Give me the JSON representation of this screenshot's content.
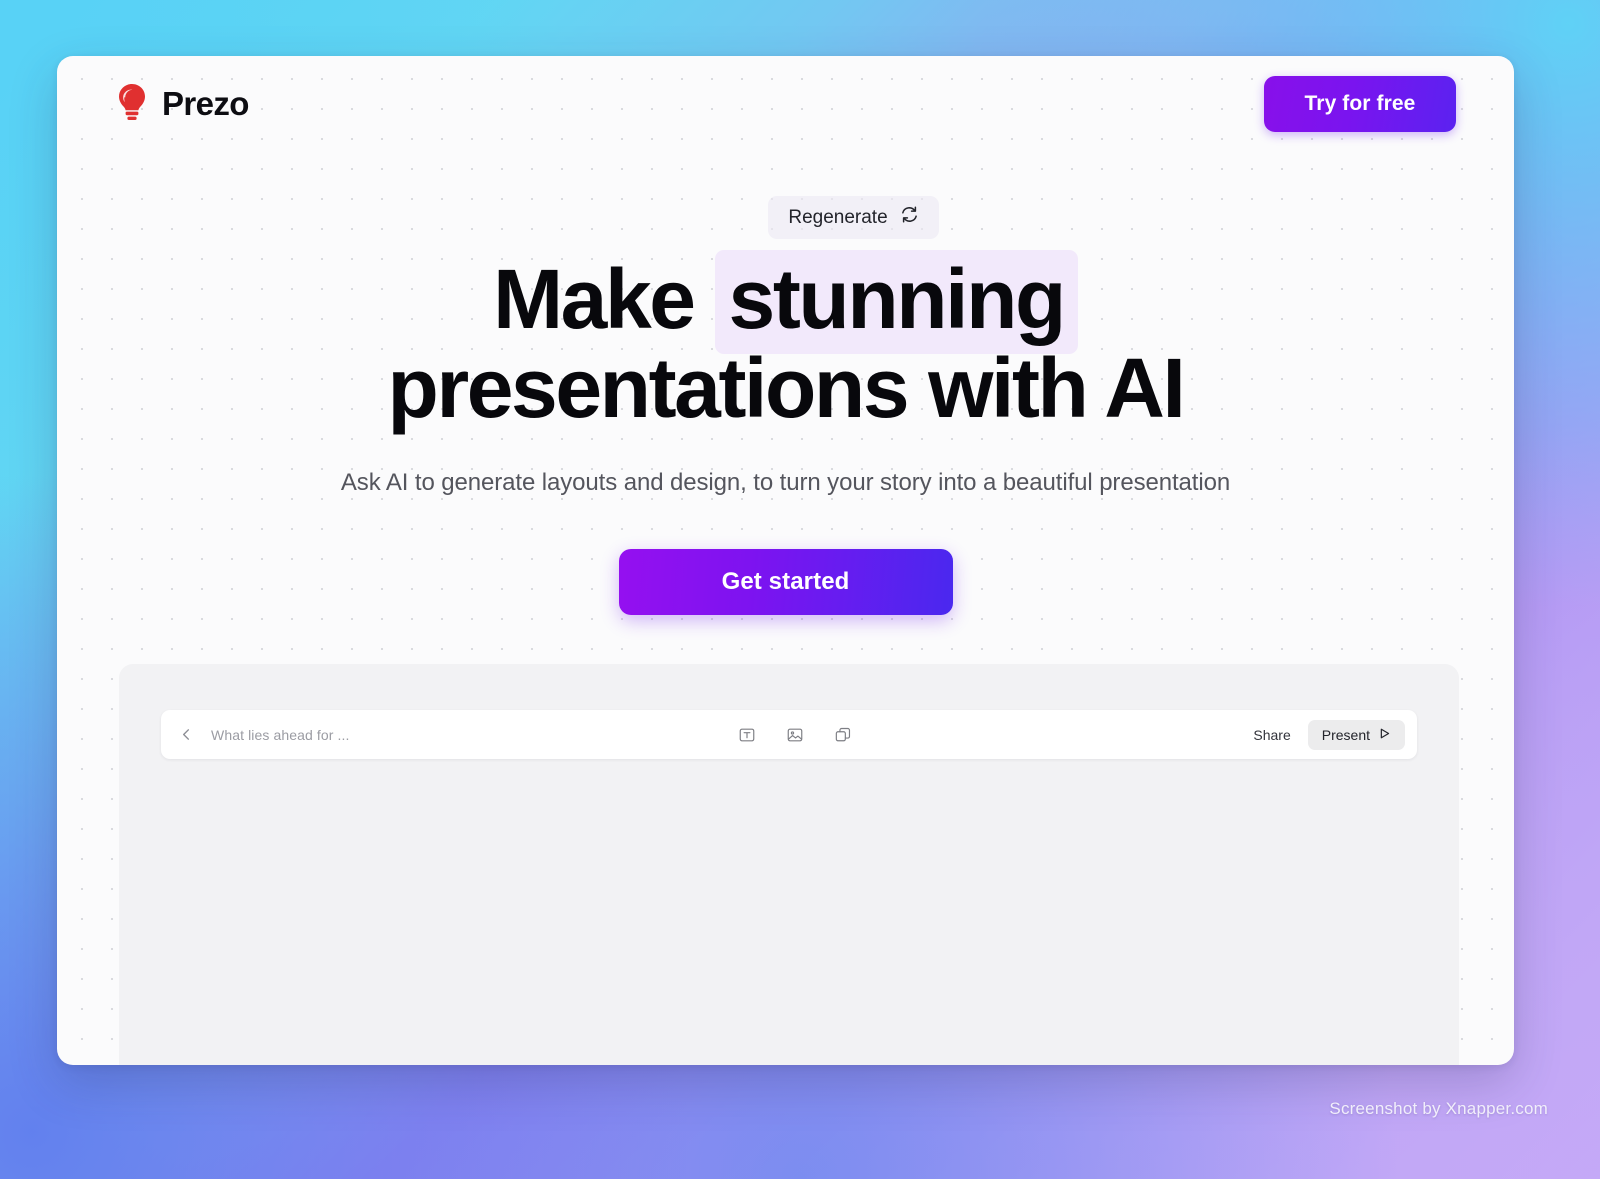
{
  "header": {
    "brand_name": "Prezo",
    "brand_icon": "lightbulb-icon",
    "brand_color": "#e23333",
    "cta_label": "Try for free"
  },
  "hero": {
    "regenerate_label": "Regenerate",
    "regenerate_icon": "refresh-cycle-icon",
    "headline_part1": "Make ",
    "headline_highlight": "stunning",
    "headline_part2": "presentations with AI",
    "highlight_color": "#f2e9fb",
    "subtitle": "Ask AI to generate layouts and design, to turn your story into a beautiful presentation",
    "cta_label": "Get started",
    "cta_gradient_from": "#9510f0",
    "cta_gradient_to": "#4a28ef"
  },
  "editor": {
    "back_icon": "chevron-left-icon",
    "deck_title": "What lies ahead for ...",
    "tools": [
      {
        "name": "text-box-icon",
        "label": "Text"
      },
      {
        "name": "image-icon",
        "label": "Image"
      },
      {
        "name": "shapes-icon",
        "label": "Shapes"
      }
    ],
    "share_label": "Share",
    "present_label": "Present",
    "present_icon": "play-icon"
  },
  "watermark": {
    "text": "Screenshot by Xnapper.com"
  }
}
